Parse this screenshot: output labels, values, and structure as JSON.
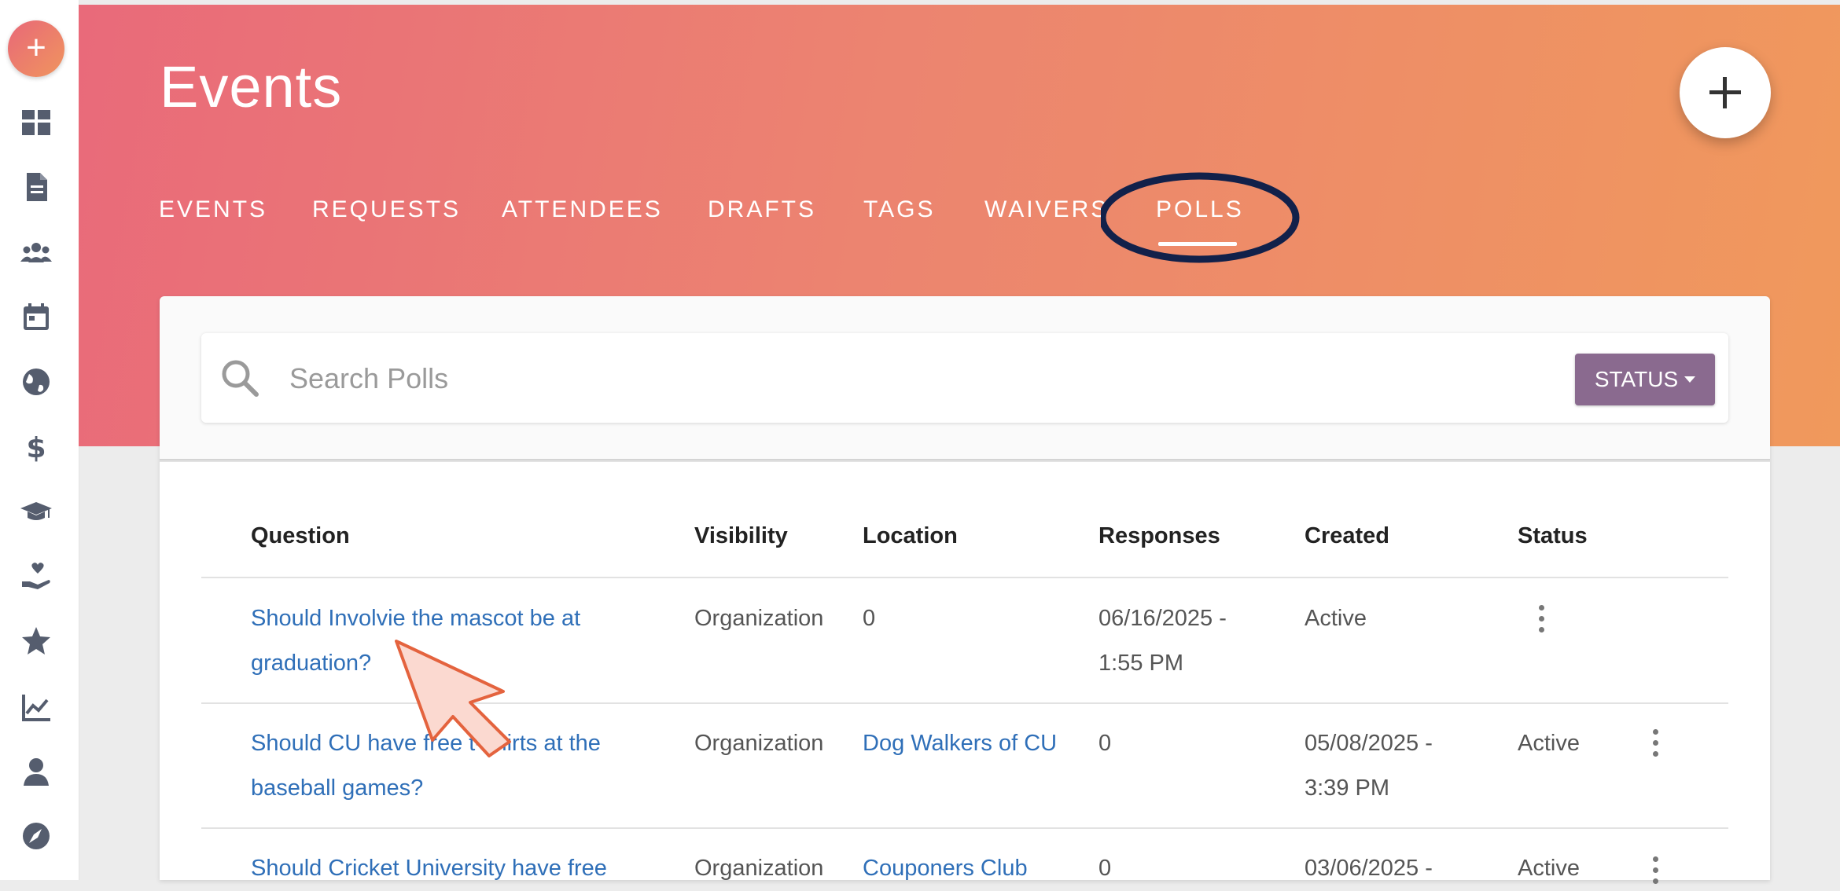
{
  "app": {
    "title": "Events",
    "accent_gradient": [
      "#e96a7a",
      "#f0995c"
    ],
    "status_button_color": "#8a6a8f",
    "link_color": "#2f6fb8"
  },
  "sidebar": {
    "add_label": "+",
    "items": [
      {
        "icon": "dashboard-icon"
      },
      {
        "icon": "document-icon"
      },
      {
        "icon": "groups-icon"
      },
      {
        "icon": "calendar-icon"
      },
      {
        "icon": "globe-icon"
      },
      {
        "icon": "dollar-icon"
      },
      {
        "icon": "graduation-cap-icon"
      },
      {
        "icon": "heart-hand-icon"
      },
      {
        "icon": "star-icon"
      },
      {
        "icon": "trending-chart-icon"
      },
      {
        "icon": "person-icon"
      },
      {
        "icon": "compass-icon"
      }
    ]
  },
  "tabs": [
    {
      "label": "EVENTS"
    },
    {
      "label": "REQUESTS"
    },
    {
      "label": "ATTENDEES"
    },
    {
      "label": "DRAFTS"
    },
    {
      "label": "TAGS"
    },
    {
      "label": "WAIVERS"
    },
    {
      "label": "POLLS",
      "active": true
    }
  ],
  "search": {
    "placeholder": "Search Polls",
    "value": "",
    "status_label": "STATUS"
  },
  "table": {
    "headers": [
      "Question",
      "Visibility",
      "Location",
      "Responses",
      "Created",
      "Status"
    ],
    "rows": [
      {
        "question_line1": "Should Involvie the mascot be at",
        "question_line2": "graduation?",
        "visibility": "Organization",
        "location": "",
        "responses": "0",
        "created_line1": "06/16/2025 -",
        "created_line2": "1:55 PM",
        "status": "Active"
      },
      {
        "question_line1": "Should CU have free t-shirts at the",
        "question_line2": "baseball games?",
        "visibility": "Organization",
        "location": "Dog Walkers of CU",
        "responses": "0",
        "created_line1": "05/08/2025 -",
        "created_line2": "3:39 PM",
        "status": "Active"
      },
      {
        "question_line1": "Should Cricket University have free",
        "visibility": "Organization",
        "location": "Couponers Club",
        "responses": "0",
        "created_line1": "03/06/2025 -",
        "status": "Active"
      }
    ]
  }
}
